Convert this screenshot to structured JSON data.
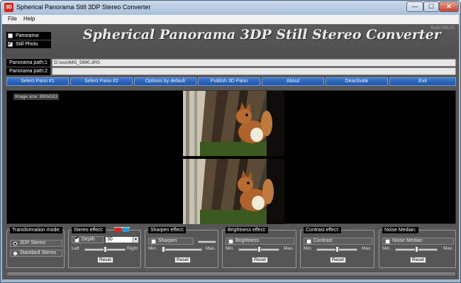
{
  "window": {
    "title": "Spherical Panorama Still 3DP Stereo Converter",
    "icon_text": "3D",
    "controls": {
      "minimize": "—",
      "maximize": "☐",
      "close": "✕"
    }
  },
  "menu": {
    "items": [
      "File",
      "Help"
    ]
  },
  "header": {
    "app_title": "Spherical Panorama 3DP Still Stereo Converter",
    "build": "Build 005.01",
    "modes": [
      {
        "label": "Panorama",
        "checked": false
      },
      {
        "label": "Still Photo",
        "checked": true
      }
    ]
  },
  "paths": {
    "path1_label": "Panorama path:1",
    "path1_value": "G:\\sss\\IMG_5990.JPG",
    "path2_label": "Panorama path:2",
    "path2_value": ""
  },
  "toolbar": {
    "buttons": [
      "Select Pano #1",
      "Select Pano #2",
      "Options by default",
      "Publish 3D Pano",
      "About",
      "Deactivate",
      "Exit"
    ]
  },
  "preview": {
    "image_size": "Image size: 800x533"
  },
  "transformation": {
    "title": "Transformation mode:",
    "options": [
      {
        "label": "3DP Stereo",
        "selected": true
      },
      {
        "label": "Standard Stereo",
        "selected": false
      }
    ]
  },
  "stereo": {
    "title": "Stereo effect:",
    "depth_label": "Depth",
    "depth_checked": true,
    "depth_value": "30",
    "left_label": "Left",
    "right_label": "Right",
    "reset_label": "Reset",
    "slider_level": 0.5
  },
  "sharpen": {
    "title": "Sharpen effect:",
    "label": "Sharpen",
    "checked": false,
    "min_label": "Min.",
    "max_label": "Max.",
    "reset_label": "Reset",
    "slider_level": 0.0
  },
  "brightness": {
    "title": "Brightness effect:",
    "label": "Brightness",
    "checked": false,
    "min_label": "Min.",
    "max_label": "Max.",
    "reset_label": "Reset",
    "slider_level": 0.5
  },
  "contrast": {
    "title": "Contrast effect:",
    "label": "Contrast",
    "checked": false,
    "min_label": "Min.",
    "max_label": "Max.",
    "reset_label": "Reset",
    "slider_level": 0.5
  },
  "noise": {
    "title": "Noise Median:",
    "label": "Noise Median",
    "checked": false,
    "min_label": "Min.",
    "max_label": "Max.",
    "reset_label": "Reset",
    "slider_level": 0.5
  },
  "colors": {
    "toolbar_blue": "#2a62bd",
    "client_gray": "#565656",
    "preview_black": "#000000",
    "close_red": "#c7412a",
    "stereo_red": "#e0201c",
    "stereo_cyan": "#1aa3d6"
  },
  "icons": {
    "app": "3d-app-icon",
    "stereo_glasses": "3d-glasses-icon",
    "dropdown": "chevron-down-icon"
  }
}
